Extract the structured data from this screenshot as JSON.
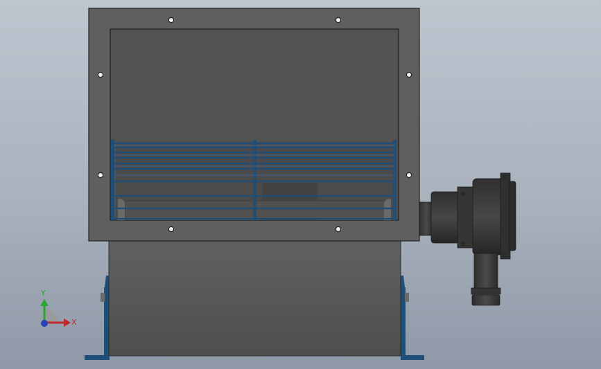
{
  "viewport": {
    "background_top": "#bfc5cf",
    "background_bottom": "#8f98a7"
  },
  "model": {
    "description_icon": "centrifugal-blower-3d-model",
    "housing_color": "#555555",
    "frame_color": "#5f5f5f",
    "grille_color": "#1f4e79",
    "motor_color": "#3a3a3a"
  },
  "triad": {
    "x_label": "X",
    "y_label": "Y",
    "x_color": "#c0282e",
    "y_color": "#2aa52f",
    "z_color": "#2b3fb8"
  }
}
